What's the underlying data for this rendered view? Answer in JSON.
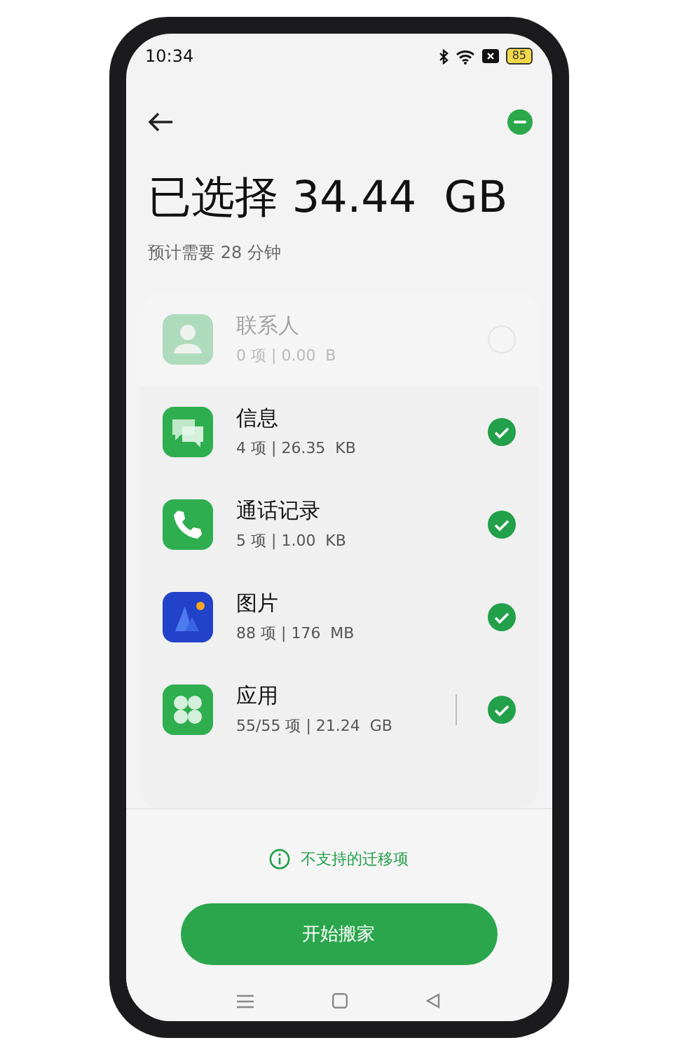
{
  "status_bar": {
    "time": "10:34",
    "battery": "85"
  },
  "header": {
    "title": "已选择 34.44  GB",
    "subtitle": "预计需要 28 分钟"
  },
  "items": [
    {
      "kind": "contacts",
      "name": "联系人",
      "detail": "0 项 | 0.00  B",
      "checked": false,
      "disabled": true,
      "divider": false
    },
    {
      "kind": "messages",
      "name": "信息",
      "detail": "4 项 | 26.35  KB",
      "checked": true,
      "disabled": false,
      "divider": false
    },
    {
      "kind": "calls",
      "name": "通话记录",
      "detail": "5 项 | 1.00  KB",
      "checked": true,
      "disabled": false,
      "divider": false
    },
    {
      "kind": "photos",
      "name": "图片",
      "detail": "88 项 | 176  MB",
      "checked": true,
      "disabled": false,
      "divider": false
    },
    {
      "kind": "apps",
      "name": "应用",
      "detail": "55/55 项 | 21.24  GB",
      "checked": true,
      "disabled": false,
      "divider": true
    }
  ],
  "unsupported_link": "不支持的迁移项",
  "start_button": "开始搬家"
}
